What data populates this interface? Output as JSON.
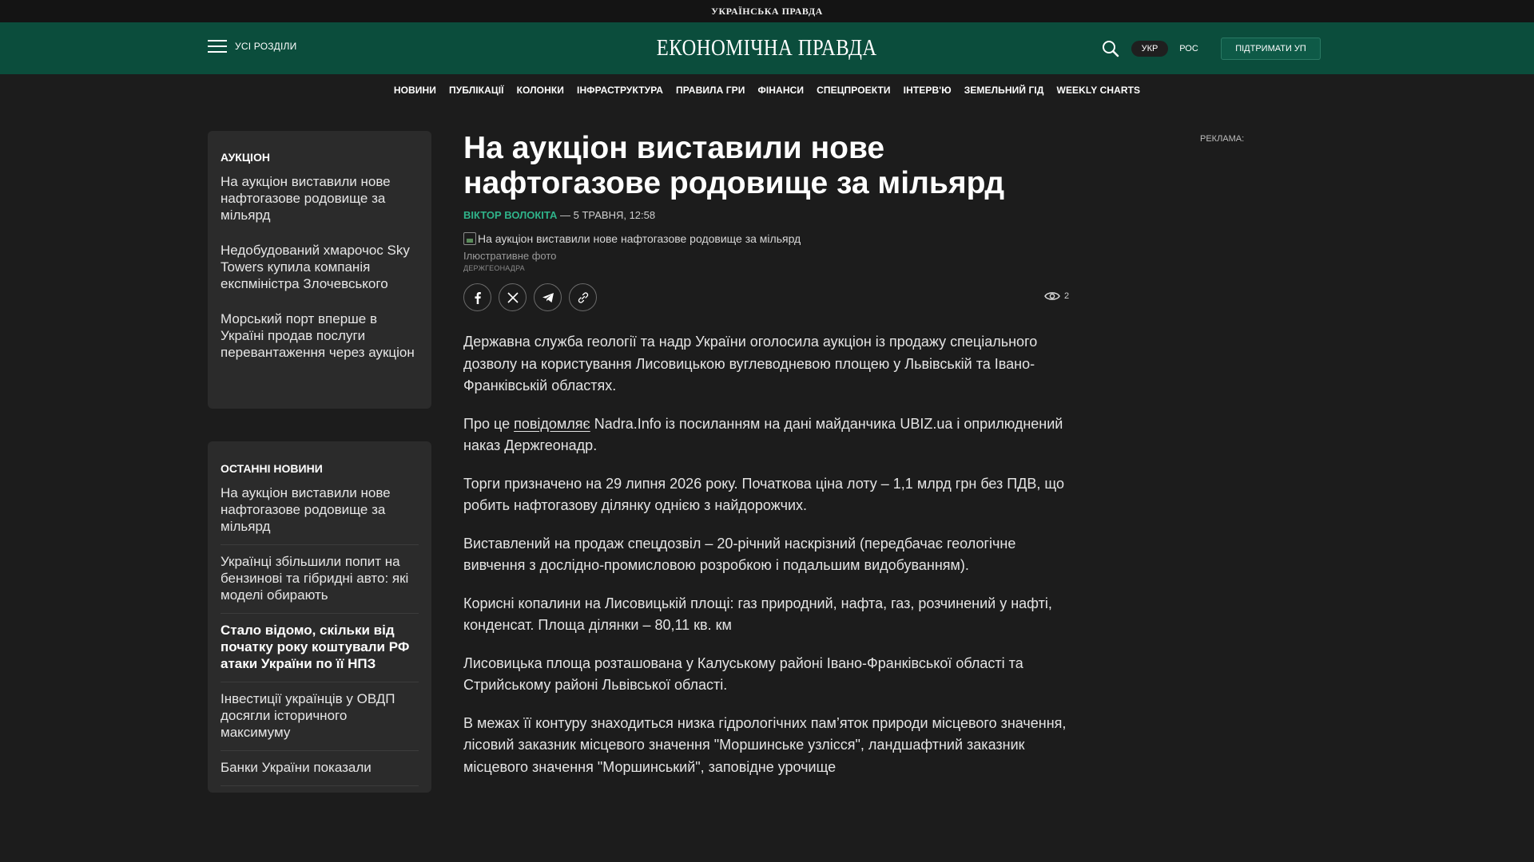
{
  "topbar": {
    "logo": "УКРАЇНСЬКА ПРАВДА"
  },
  "header": {
    "menu_label": "УСІ РОЗДІЛИ",
    "brand": "ЕКОНОМІЧНА ПРАВДА",
    "lang_ukr": "УКР",
    "lang_ros": "РОС",
    "support_label": "ПІДТРИМАТИ УП",
    "colors": {
      "header_bg": "#0b4d3c",
      "accent": "#2fb38a"
    }
  },
  "nav": {
    "items": [
      "НОВИНИ",
      "ПУБЛІКАЦІЇ",
      "КОЛОНКИ",
      "ІНФРАСТРУКТУРА",
      "ПРАВИЛА ГРИ",
      "ФІНАНСИ",
      "СПЕЦПРОЕКТИ",
      "ІНТЕРВ'Ю",
      "ЗЕМЕЛЬНИЙ ГІД",
      "WEEKLY CHARTS"
    ]
  },
  "sidebar": {
    "tag_box": {
      "title": "АУКЦІОН",
      "items": [
        "На аукціон виставили нове нафтогазове родовище за мільярд",
        "Недобудований хмарочос Sky Towers купила компанія експміністра Злочевського",
        "Морський порт вперше в Україні продав послуги перевантаження через аукціон"
      ]
    },
    "latest": {
      "title": "ОСТАННІ НОВИНИ",
      "items": [
        "На аукціон виставили нове нафтогазове родовище за мільярд",
        "Українці збільшили попит на бензинові та гібридні авто: які моделі обирають",
        "Стало відомо, скільки від початку року коштували РФ атаки України по її НПЗ",
        "Інвестиції українців у ОВДП досягли історичного максимуму",
        "Банки України показали"
      ]
    }
  },
  "article": {
    "title": "На аукціон виставили нове нафтогазове родовище за мільярд",
    "author": "ВІКТОР ВОЛОКІТА",
    "date": " — 5 ТРАВНЯ, 12:58",
    "image_alt": "На аукціон виставили нове нафтогазове родовище за мільярд",
    "caption": "Ілюстративне фото",
    "credit": "ДЕРЖГЕОНАДРА",
    "views": "2",
    "share_icons": [
      "facebook-icon",
      "x-icon",
      "telegram-icon",
      "link-icon"
    ],
    "paragraphs": {
      "p1": "Державна служба геології та надр України оголосила аукціон із продажу спеціального дозволу на користування Лисовицькою вуглеводневою площею у Львівській та Івано-Франківській областях.",
      "p2_before": "Про це ",
      "p2_link": "повідомляє",
      "p2_after": " Nadra.Info із посиланням на дані майданчика UBIZ.ua і оприлюднений наказ Держгеонадр.",
      "p3": "Торги призначено на 29 липня 2026 року. Початкова ціна лоту – 1,1 млрд грн без ПДВ, що робить нафтогазову ділянку однією з найдорожчих.",
      "p4": "Виставлений на продаж спецдозвіл – 20-річний наскрізний (передбачає геологічне вивчення з дослідно-промисловою розробкою і подальшим видобуванням).",
      "p5": "Корисні копалини на Лисовицькій площі: газ природний, нафта, газ, розчинений у нафті, конденсат. Площа ділянки – 80,11 кв. км",
      "p6": "Лисовицька площа розташована у Калуському районі Івано-Франківської області та Стрийському районі Львівської області.",
      "p7": "В межах її контуру знаходиться низка гідрологічних пам’яток природи місцевого значення, лісовий заказник місцевого значення \"Моршинське узлісся\", ландшафтний заказник місцевого значення \"Моршинський\", заповідне урочище"
    }
  },
  "ads": {
    "label": "РЕКЛАМА:"
  }
}
